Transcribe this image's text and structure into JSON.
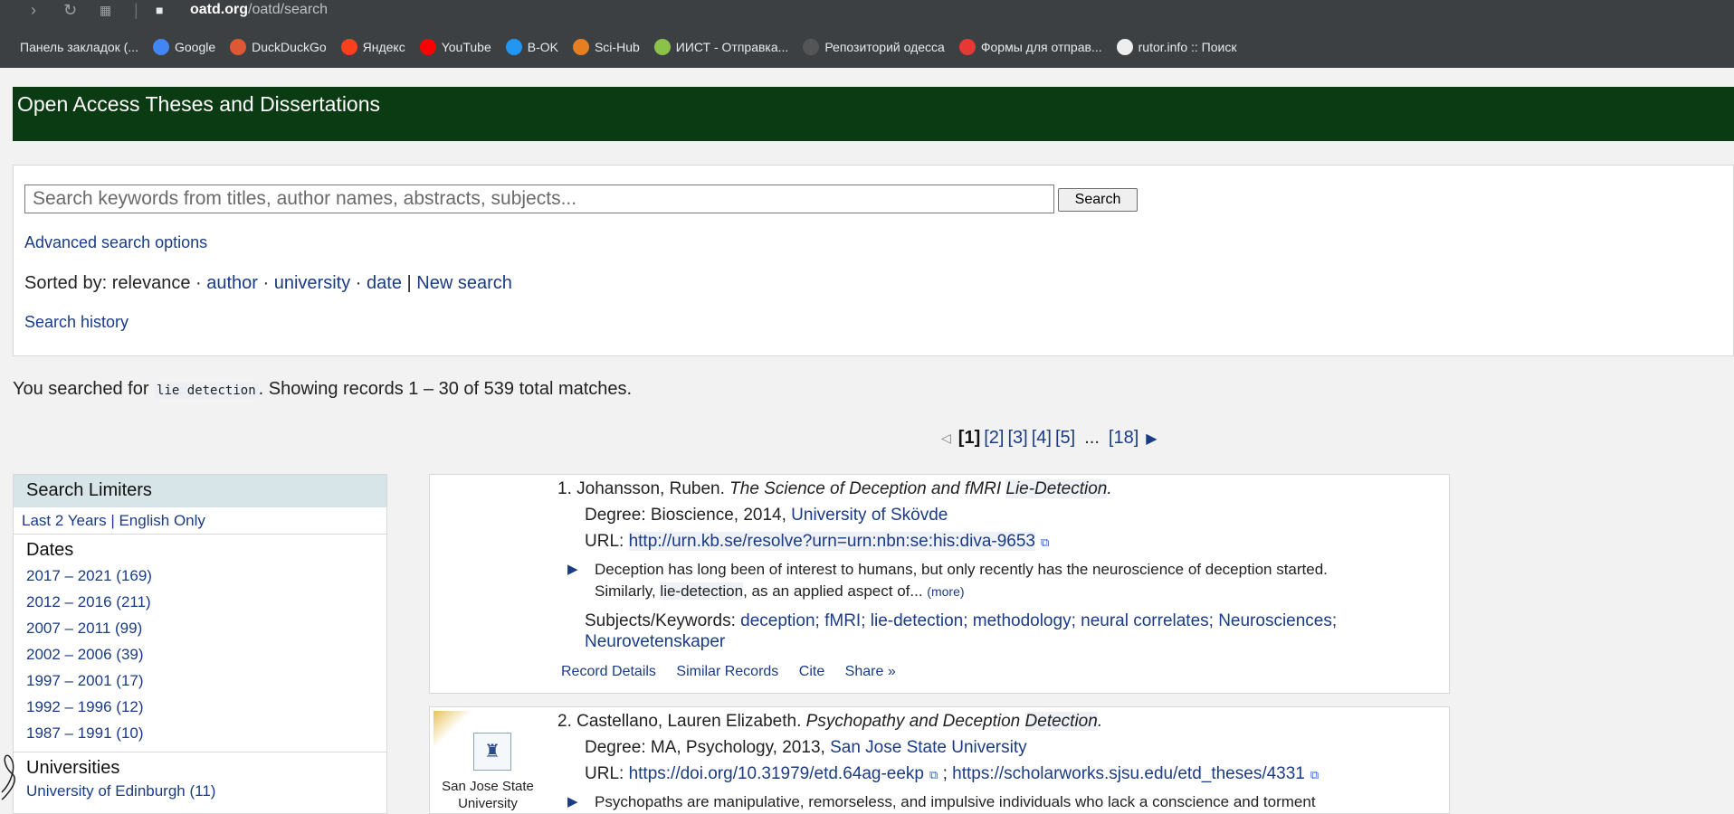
{
  "browser": {
    "url_host": "oatd.org",
    "url_path": "/oatd/search",
    "bookmarks": [
      {
        "label": "Панель закладок (...",
        "icon": "bookmarks-panel-icon",
        "color": "#3c4043"
      },
      {
        "label": "Google",
        "icon": "google-icon",
        "color": "#4285f4"
      },
      {
        "label": "DuckDuckGo",
        "icon": "duckduckgo-icon",
        "color": "#de5833"
      },
      {
        "label": "Яндекс",
        "icon": "yandex-icon",
        "color": "#fc3f1d"
      },
      {
        "label": "YouTube",
        "icon": "youtube-icon",
        "color": "#ff0000"
      },
      {
        "label": "B-OK",
        "icon": "globe-icon",
        "color": "#2196f3"
      },
      {
        "label": "Sci-Hub",
        "icon": "scihub-icon",
        "color": "#e67e22"
      },
      {
        "label": "ИИСТ - Отправка...",
        "icon": "iist-icon",
        "color": "#8bc34a"
      },
      {
        "label": "Репозиторий одесса",
        "icon": "d-icon",
        "color": "#555555"
      },
      {
        "label": "Формы для отправ...",
        "icon": "forms-icon",
        "color": "#e53935"
      },
      {
        "label": "rutor.info :: Поиск",
        "icon": "page-icon",
        "color": "#eeeeee"
      }
    ]
  },
  "site": {
    "title": "Open Access Theses and Dissertations",
    "header_color": "#0b3b12"
  },
  "search": {
    "placeholder": "Search keywords from titles, author names, abstracts, subjects...",
    "button": "Search",
    "advanced": "Advanced search options",
    "sorted_prefix": "Sorted by: relevance ·",
    "sort_author": "author",
    "sort_sep1": "·",
    "sort_university": "university",
    "sort_sep2": "·",
    "sort_date": "date",
    "sort_sep3": "|",
    "new_search": "New search",
    "history": "Search history"
  },
  "summary": {
    "prefix": "You searched for",
    "query": "lie detection",
    "suffix": ". Showing records 1 – 30 of 539 total matches."
  },
  "pager": {
    "prev": "◁",
    "current": "[1]",
    "pages": [
      "[2]",
      "[3]",
      "[4]",
      "[5]"
    ],
    "ellipsis": "...",
    "last": "[18]",
    "next": "▶"
  },
  "limiters": {
    "title": "Search Limiters",
    "quick_last": "Last 2 Years",
    "quick_sep": "|",
    "quick_english": "English Only",
    "dates_title": "Dates",
    "dates": [
      {
        "range": "2017 – 2021",
        "count": "(169)"
      },
      {
        "range": "2012 – 2016",
        "count": "(211)"
      },
      {
        "range": "2007 – 2011",
        "count": "(99)"
      },
      {
        "range": "2002 – 2006",
        "count": "(39)"
      },
      {
        "range": "1997 – 2001",
        "count": "(17)"
      },
      {
        "range": "1992 – 1996",
        "count": "(12)"
      },
      {
        "range": "1987 – 1991",
        "count": "(10)"
      }
    ],
    "universities_title": "Universities",
    "universities": [
      {
        "name": "University of Edinburgh",
        "count": "(11)"
      }
    ]
  },
  "results": [
    {
      "num": "1.",
      "author": "Johansson, Ruben.",
      "title_a": "The Science of Deception and fMRI",
      "title_b": "Lie-Detection",
      "title_end": ".",
      "degree_prefix": "Degree: Bioscience, 2014,",
      "university": "University of Skövde",
      "url_prefix": "URL:",
      "url": "http://urn.kb.se/resolve?urn=urn:nbn:se:his:diva-9653",
      "abstract_a": "Deception has long been of interest to humans, but only recently has the neuroscience of deception started.",
      "abstract_b": "Similarly,",
      "abstract_hl": "lie-detection",
      "abstract_c": ", as an applied aspect of...",
      "more": "(more)",
      "subjects_prefix": "Subjects/Keywords:",
      "subjects_1": "deception; fMRI; lie-detection; methodology; neural correlates; Neurosciences;",
      "subjects_2": "Neurovetenskaper",
      "actions": [
        "Record Details",
        "Similar Records",
        "Cite",
        "Share »"
      ]
    },
    {
      "num": "2.",
      "author": "Castellano, Lauren Elizabeth.",
      "title_a": "Psychopathy and Deception",
      "title_b": "Detection",
      "title_end": ".",
      "degree_prefix": "Degree: MA, Psychology, 2013,",
      "university": "San Jose State University",
      "url_prefix": "URL:",
      "url": "https://doi.org/10.31979/etd.64ag-eekp",
      "url_sep": ";",
      "url2": "https://scholarworks.sjsu.edu/etd_theses/4331",
      "abstract_a": "Psychopaths are manipulative, remorseless, and impulsive individuals who lack a conscience and torment",
      "thumb_name_1": "San Jose State",
      "thumb_name_2": "University"
    }
  ]
}
